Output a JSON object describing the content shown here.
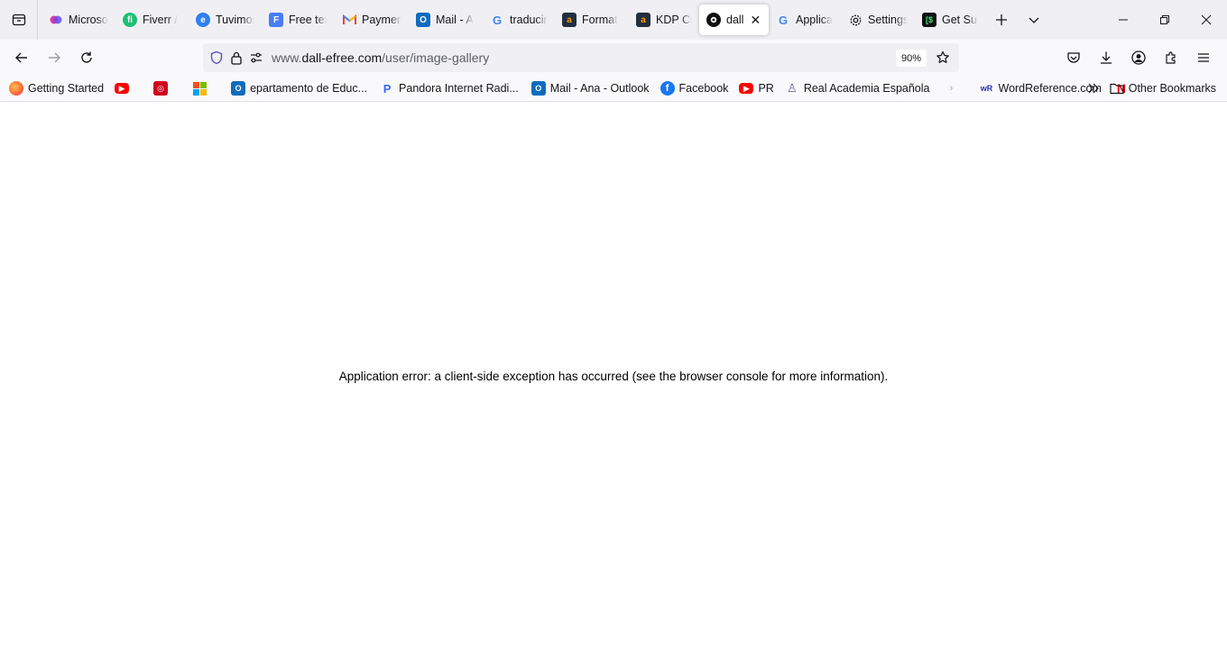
{
  "browser": {
    "tabs": [
      {
        "title": "Microsoft",
        "icon": "copilot-icon",
        "color": "#c239b3"
      },
      {
        "title": "Fiverr / ",
        "icon": "fiverr-icon",
        "color": "#1dbf73"
      },
      {
        "title": "Tuvimos",
        "icon": "tuvimos-icon",
        "color": "#2f7ff2"
      },
      {
        "title": "Free text",
        "icon": "forms-icon",
        "color": "#4a7cf6"
      },
      {
        "title": "Payment",
        "icon": "gmail-icon",
        "color": "#ea4335"
      },
      {
        "title": "Mail - A",
        "icon": "outlook-icon",
        "color": "#0f6cbd"
      },
      {
        "title": "traducir",
        "icon": "google-icon",
        "color": "#4285f4"
      },
      {
        "title": "Format",
        "icon": "amazon-icon",
        "color": "#232f3e"
      },
      {
        "title": "KDP Co",
        "icon": "amazon-icon",
        "color": "#232f3e"
      },
      {
        "title": "dall-",
        "icon": "dall-e-icon",
        "color": "#111111",
        "active": true
      },
      {
        "title": "Applica",
        "icon": "google-icon",
        "color": "#4285f4"
      },
      {
        "title": "Settings",
        "icon": "gear-icon",
        "color": "#15141a"
      },
      {
        "title": "Get Sup",
        "icon": "terminal-icon",
        "color": "#111111"
      }
    ],
    "url": {
      "prefix": "www.",
      "host": "dall-efree.com",
      "path": "/user/image-gallery"
    },
    "zoom": "90%",
    "bookmarks": [
      {
        "label": "Getting Started",
        "icon": "firefox-icon",
        "color": "#ff7139"
      },
      {
        "label": "",
        "icon": "youtube-icon",
        "color": "#ff0000"
      },
      {
        "label": "",
        "icon": "red-logo-icon",
        "color": "#d0021b"
      },
      {
        "label": "",
        "icon": "microsoft-icon",
        "color": "#f25022"
      },
      {
        "label": "epartamento de Educ...",
        "icon": "outlook-icon",
        "color": "#0f6cbd"
      },
      {
        "label": "Pandora Internet Radi...",
        "icon": "pandora-icon",
        "color": "#3668ff"
      },
      {
        "label": "Mail - Ana - Outlook",
        "icon": "outlook-icon",
        "color": "#0f6cbd"
      },
      {
        "label": "Facebook",
        "icon": "facebook-icon",
        "color": "#1877f2"
      },
      {
        "label": "PR",
        "icon": "youtube-icon",
        "color": "#ff0000"
      },
      {
        "label": "Real Academia Española",
        "icon": "rae-icon",
        "color": "#6a6a8a"
      },
      {
        "label": "",
        "icon": "blank-icon",
        "color": "#bbbbbb"
      },
      {
        "label": "WordReference.com",
        "icon": "wordreference-icon",
        "color": "#2b2baf"
      },
      {
        "label": "",
        "icon": "netflix-icon",
        "color": "#e50914"
      }
    ],
    "other_bookmarks": "Other Bookmarks"
  },
  "page": {
    "error_message": "Application error: a client-side exception has occurred (see the browser console for more information)."
  }
}
